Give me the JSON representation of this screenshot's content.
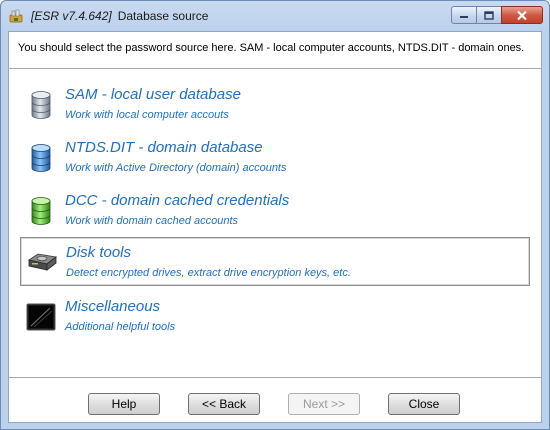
{
  "window": {
    "version": "[ESR v7.4.642]",
    "title": "Database source"
  },
  "instruction": "You should select the password source here. SAM - local computer accounts, NTDS.DIT - domain ones.",
  "options": [
    {
      "title": "SAM - local user database",
      "description": "Work with local computer accouts",
      "icon": "database-icon",
      "color": "#9aa5b1",
      "selected": false
    },
    {
      "title": "NTDS.DIT - domain database",
      "description": "Work with Active Directory (domain) accounts",
      "icon": "database-icon",
      "color": "#3b86d6",
      "selected": false
    },
    {
      "title": "DCC - domain cached credentials",
      "description": "Work with domain cached accounts",
      "icon": "database-icon",
      "color": "#4cbf2e",
      "selected": false
    },
    {
      "title": "Disk tools",
      "description": "Detect encrypted drives, extract drive encryption keys, etc.",
      "icon": "hard-drive-icon",
      "selected": true
    },
    {
      "title": "Miscellaneous",
      "description": "Additional helpful tools",
      "icon": "terminal-icon",
      "selected": false
    }
  ],
  "buttons": {
    "help": "Help",
    "back": "<< Back",
    "next": "Next >>",
    "close": "Close"
  },
  "colors": {
    "link": "#1f6fc2",
    "titlebar": "#c9daf0",
    "close_button": "#c2402b"
  }
}
